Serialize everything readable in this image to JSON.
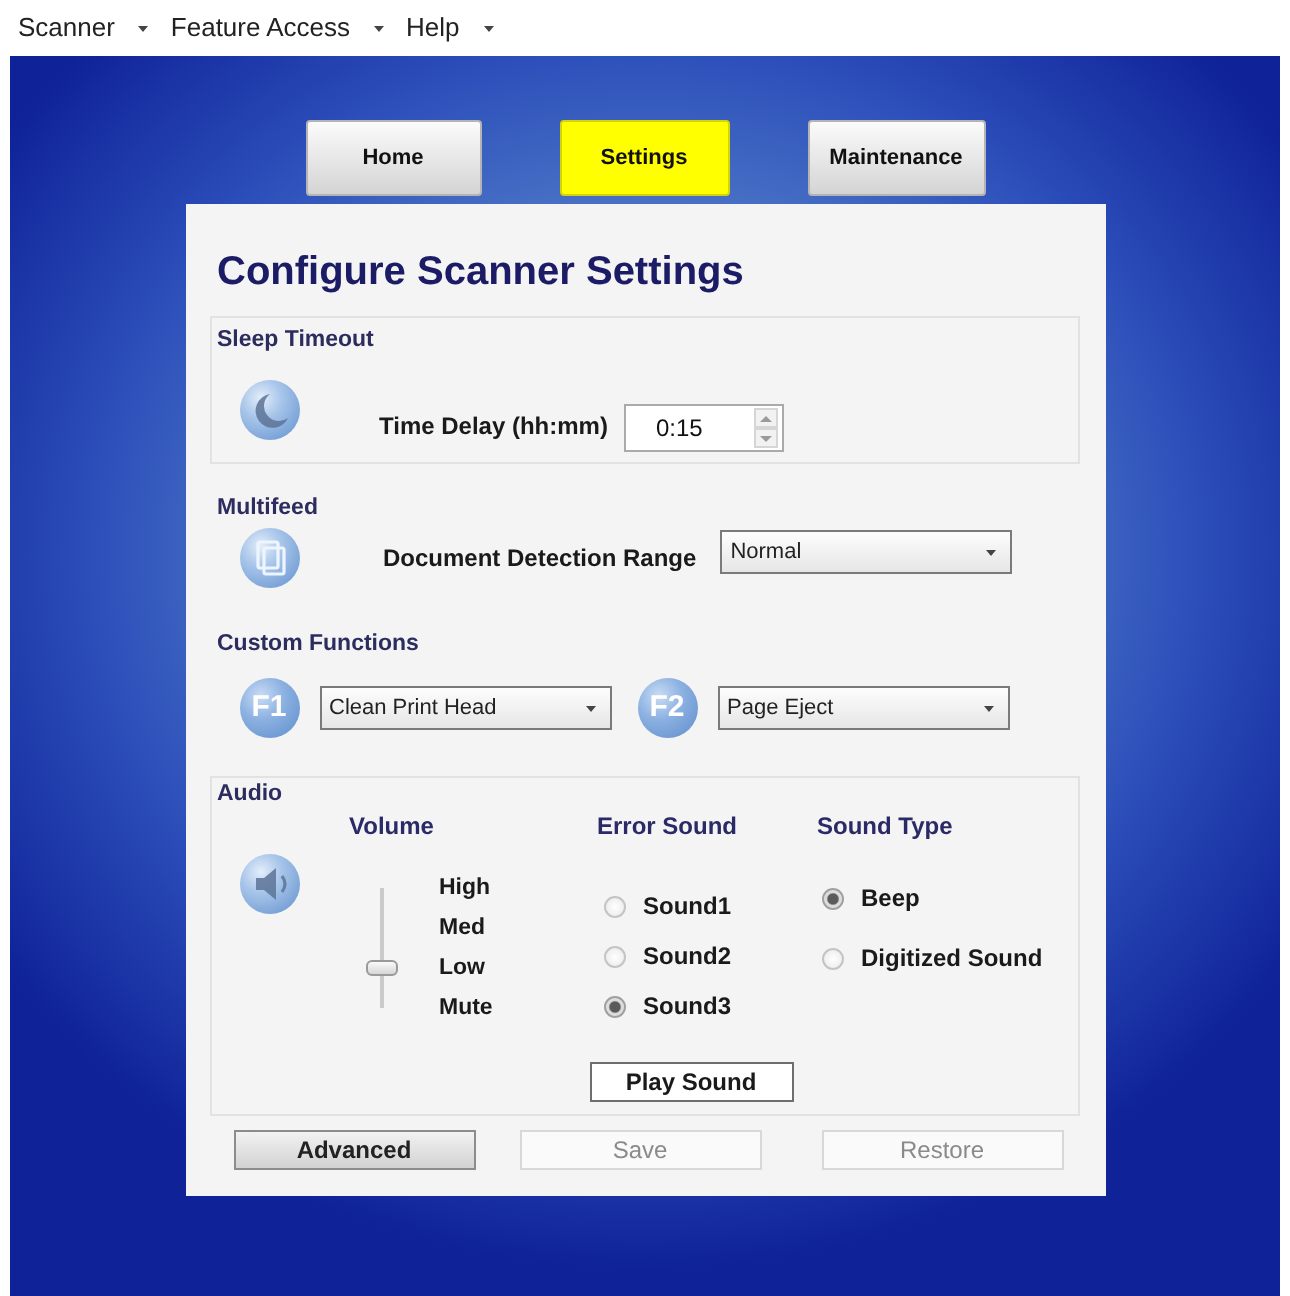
{
  "menu_bar": [
    {
      "label": "Scanner"
    },
    {
      "label": "Feature Access"
    },
    {
      "label": "Help"
    }
  ],
  "tabs": [
    {
      "label": "Home",
      "selected": false
    },
    {
      "label": "Settings",
      "selected": true
    },
    {
      "label": "Maintenance",
      "selected": false
    }
  ],
  "title": "Configure Scanner Settings",
  "sleep_timeout": {
    "heading": "Sleep Timeout",
    "label": "Time Delay (hh:mm)",
    "value": "0:15"
  },
  "multifeed": {
    "heading": "Multifeed",
    "label": "Document Detection Range",
    "value": "Normal"
  },
  "custom_functions": {
    "heading": "Custom Functions",
    "keys": [
      {
        "key": "F1",
        "value": "Clean Print Head"
      },
      {
        "key": "F2",
        "value": "Page Eject"
      }
    ]
  },
  "audio": {
    "heading": "Audio",
    "volume": {
      "heading": "Volume",
      "steps": [
        "High",
        "Med",
        "Low",
        "Mute"
      ],
      "level": 0.33
    },
    "error_sound": {
      "heading": "Error Sound",
      "options": [
        {
          "label": "Sound1",
          "selected": false
        },
        {
          "label": "Sound2",
          "selected": false
        },
        {
          "label": "Sound3",
          "selected": true
        }
      ]
    },
    "sound_type": {
      "heading": "Sound Type",
      "options": [
        {
          "label": "Beep",
          "selected": true
        },
        {
          "label": "Digitized Sound",
          "selected": false
        }
      ]
    },
    "play_button": "Play Sound"
  },
  "buttons": [
    {
      "label": "Advanced",
      "disabled": false
    },
    {
      "label": "Save",
      "disabled": true
    },
    {
      "label": "Restore",
      "disabled": true
    }
  ]
}
